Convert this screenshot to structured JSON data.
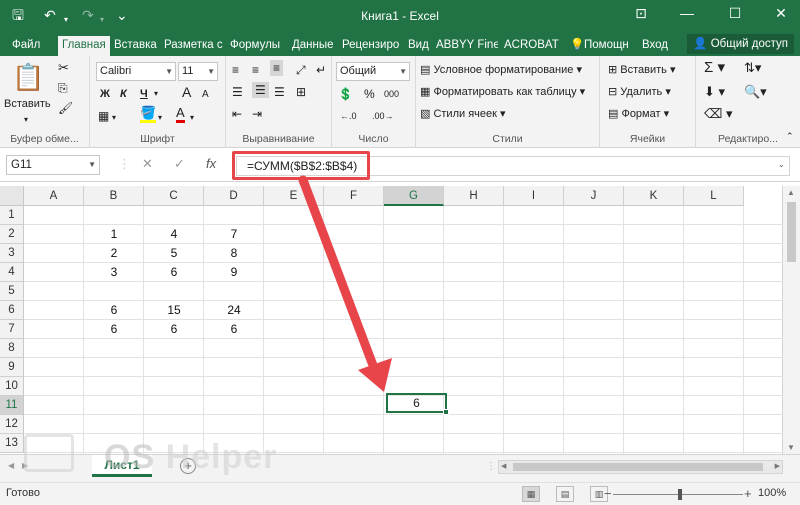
{
  "titlebar": {
    "title": "Книга1 - Excel",
    "icons": [
      "save-icon",
      "undo-icon",
      "redo-icon",
      "customize-icon",
      "ribbon-display-icon",
      "minimize-icon",
      "maximize-icon",
      "close-icon"
    ],
    "save_glyph": "🖫",
    "undo_glyph": "↶",
    "redo_glyph": "↷",
    "customize_glyph": "⌄",
    "ribbon_glyph": "⊡",
    "min_glyph": "—",
    "max_glyph": "☐",
    "close_glyph": "✕"
  },
  "tabs": {
    "items": [
      "Файл",
      "Главная",
      "Вставка",
      "Разметка с",
      "Формулы",
      "Данные",
      "Рецензиро",
      "Вид",
      "ABBYY Fine",
      "ACROBAT"
    ],
    "active": "Главная",
    "tell_me": "Помощн",
    "sign_in": "Вход",
    "share": "Общий доступ"
  },
  "ribbon": {
    "clipboard": {
      "paste": "Вставить",
      "label": "Буфер обме..."
    },
    "font": {
      "name": "Calibri",
      "size": "11",
      "bold": "Ж",
      "italic": "К",
      "underline": "Ч",
      "grow": "A",
      "shrink": "A",
      "font_color_glyph": "A",
      "label": "Шрифт"
    },
    "alignment": {
      "label": "Выравнивание"
    },
    "number": {
      "format": "Общий",
      "percent": "%",
      "thousands": "000",
      "label": "Число"
    },
    "styles": {
      "conditional": "Условное форматирование",
      "table": "Форматировать как таблицу",
      "cell_styles": "Стили ячеек",
      "label": "Стили"
    },
    "cells": {
      "insert": "Вставить",
      "delete": "Удалить",
      "format": "Формат",
      "label": "Ячейки"
    },
    "editing": {
      "label": "Редактиро..."
    }
  },
  "formula_bar": {
    "name_box": "G11",
    "cancel_glyph": "✕",
    "enter_glyph": "✓",
    "fx_glyph": "fx",
    "formula": "=СУММ($B$2:$B$4)"
  },
  "grid": {
    "columns": [
      "A",
      "B",
      "C",
      "D",
      "E",
      "F",
      "G",
      "H",
      "I",
      "J",
      "K",
      "L"
    ],
    "rows": [
      "1",
      "2",
      "3",
      "4",
      "5",
      "6",
      "7",
      "8",
      "9",
      "10",
      "11",
      "12",
      "13"
    ],
    "selected_col": "G",
    "selected_row": "11",
    "cells": {
      "B2": "1",
      "C2": "4",
      "D2": "7",
      "B3": "2",
      "C3": "5",
      "D3": "8",
      "B4": "3",
      "C4": "6",
      "D4": "9",
      "B6": "6",
      "C6": "15",
      "D6": "24",
      "B7": "6",
      "C7": "6",
      "D7": "6"
    },
    "active_value": "6"
  },
  "sheets": {
    "tabs": [
      "Лист1"
    ],
    "add_glyph": "+"
  },
  "statusbar": {
    "status": "Готово",
    "zoom": "100%",
    "zoom_minus": "−",
    "zoom_plus": "+"
  },
  "watermark": {
    "text_os": "OS",
    "text_helper": " Helper"
  },
  "colors": {
    "accent": "#217346",
    "highlight": "#e8454a"
  }
}
